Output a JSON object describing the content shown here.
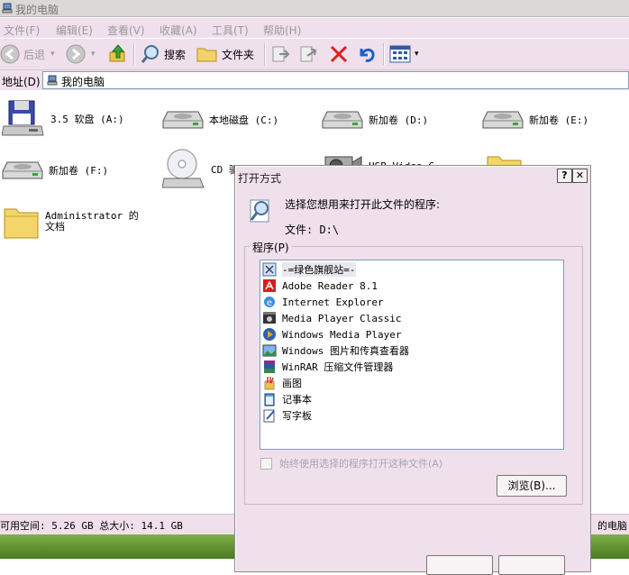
{
  "window": {
    "title": "我的电脑"
  },
  "menu": [
    "文件(F)",
    "编辑(E)",
    "查看(V)",
    "收藏(A)",
    "工具(T)",
    "帮助(H)"
  ],
  "toolbar": {
    "back": "后退",
    "search": "搜索",
    "folders": "文件夹"
  },
  "address": {
    "label": "地址(D)",
    "value": "我的电脑"
  },
  "drives": [
    {
      "label": "3.5 软盘 (A:)",
      "icon": "floppy-drive-icon"
    },
    {
      "label": "本地磁盘 (C:)",
      "icon": "hard-disk-icon"
    },
    {
      "label": "新加卷 (D:)",
      "icon": "hard-disk-icon"
    },
    {
      "label": "新加卷 (E:)",
      "icon": "hard-disk-icon"
    },
    {
      "label": "新加卷 (F:)",
      "icon": "hard-disk-icon"
    },
    {
      "label": "CD 驱",
      "icon": "cd-drive-icon"
    },
    {
      "label": "USB Video C",
      "icon": "camera-icon"
    },
    {
      "label": "",
      "icon": "folder-icon"
    },
    {
      "label": "Administrator 的文档",
      "icon": "folder-icon"
    }
  ],
  "status": {
    "left": "可用空间: 5.26 GB 总大小: 14.1 GB",
    "right": "的电脑"
  },
  "dialog": {
    "title": "打开方式",
    "help_btn": "?",
    "close_btn": "✕",
    "prompt": "选择您想用来打开此文件的程序:",
    "file_line": "文件: D:\\",
    "group_label": "程序(P)",
    "programs": [
      {
        "name": "-=绿色旗舰站=-",
        "icon": "app-icon",
        "selected": true
      },
      {
        "name": "Adobe Reader 8.1",
        "icon": "adobe-reader-icon"
      },
      {
        "name": "Internet Explorer",
        "icon": "internet-explorer-icon"
      },
      {
        "name": "Media Player Classic",
        "icon": "media-player-classic-icon"
      },
      {
        "name": "Windows Media Player",
        "icon": "windows-media-player-icon"
      },
      {
        "name": "Windows 图片和传真查看器",
        "icon": "picture-viewer-icon"
      },
      {
        "name": "WinRAR 压缩文件管理器",
        "icon": "winrar-icon"
      },
      {
        "name": "画图",
        "icon": "paint-icon"
      },
      {
        "name": "记事本",
        "icon": "notepad-icon"
      },
      {
        "name": "写字板",
        "icon": "wordpad-icon"
      }
    ],
    "always_use": "始终使用选择的程序打开这种文件(A)",
    "browse_btn": "浏览(B)..."
  },
  "colors": {
    "chrome": "#f0e0ec",
    "delete_red": "#e02020",
    "undo_blue": "#1f5fd0",
    "listbox_border": "#7f9db9"
  }
}
